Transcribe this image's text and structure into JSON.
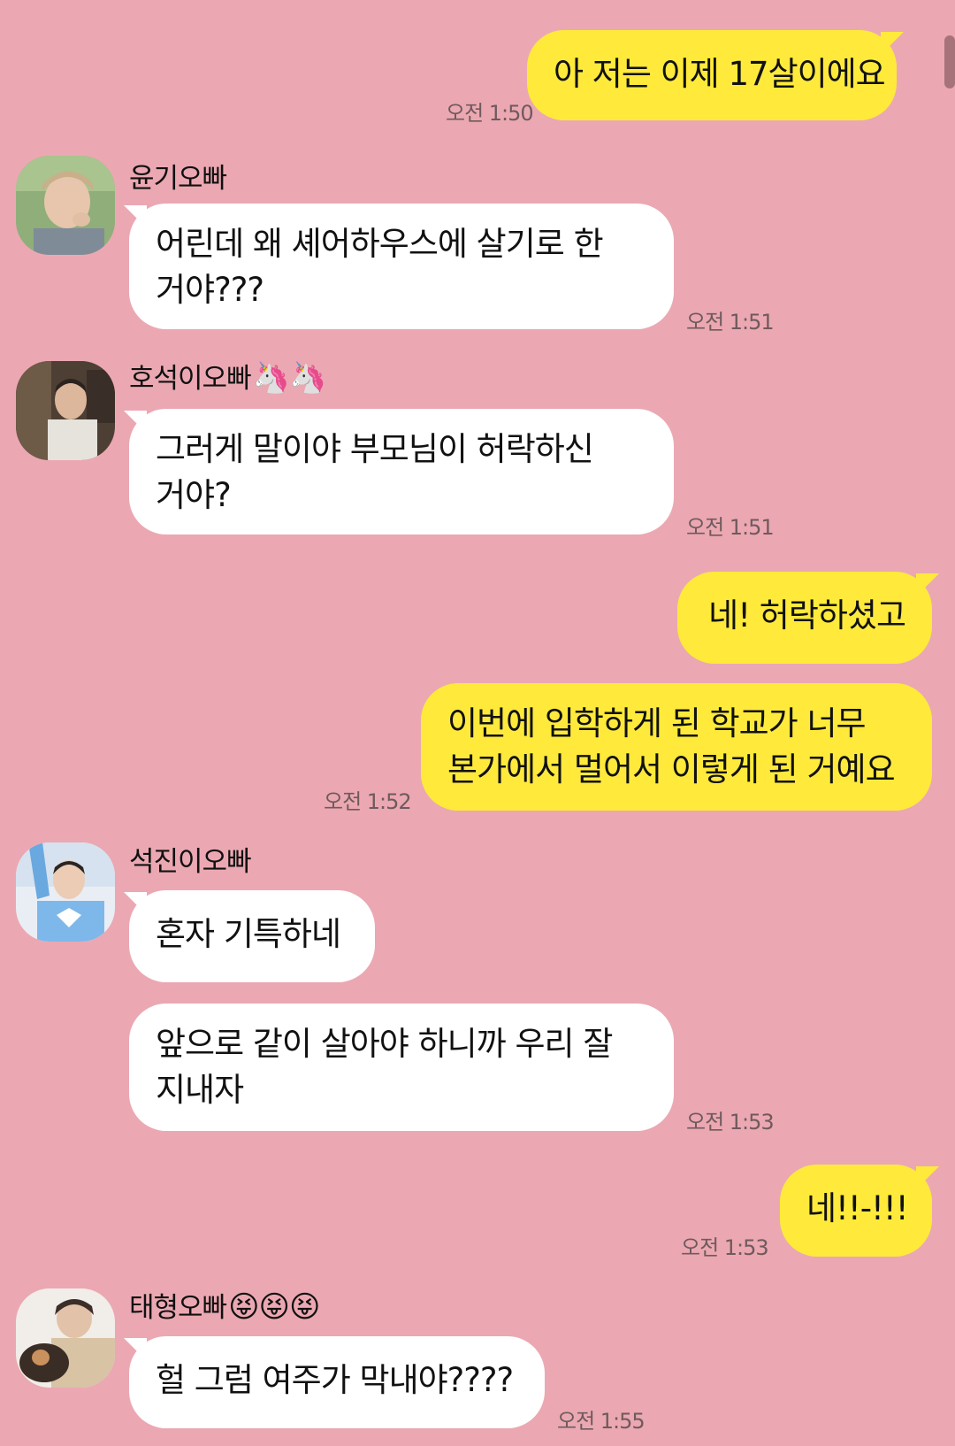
{
  "messages": [
    {
      "text_lines": [
        "아 저는 이제 17살이에요"
      ],
      "time": "오전 1:50"
    },
    {
      "sender": "윤기오빠",
      "text_lines": [
        "어린데 왜 셰어하우스에 살기로 한",
        "거야???"
      ],
      "time": "오전 1:51"
    },
    {
      "sender": "호석이오빠",
      "sender_emoji": "🦄🦄",
      "text_lines": [
        "그러게 말이야 부모님이 허락하신",
        "거야?"
      ],
      "time": "오전 1:51"
    },
    {
      "text_lines": [
        "네! 허락하셨고"
      ]
    },
    {
      "text_lines": [
        "이번에 입학하게 된 학교가 너무",
        "본가에서 멀어서 이렇게 된 거예요"
      ],
      "time": "오전 1:52"
    },
    {
      "sender": "석진이오빠",
      "text_lines": [
        "혼자 기특하네"
      ]
    },
    {
      "text_lines": [
        "앞으로 같이 살아야 하니까 우리 잘",
        "지내자"
      ],
      "time": "오전 1:53"
    },
    {
      "text_lines": [
        "네!!-!!!"
      ],
      "time": "오전 1:53"
    },
    {
      "sender": "태형오빠",
      "sender_emoji": "😝😝😝",
      "text_lines": [
        "헐 그럼 여주가 막내야????"
      ],
      "time": "오전 1:55"
    }
  ],
  "colors": {
    "background": "#eba8b2",
    "incoming_bubble": "#ffffff",
    "outgoing_bubble": "#ffea3b",
    "timestamp": "#6f5a5d"
  },
  "icons": {
    "avatar_1": "profile-photo-avatar",
    "avatar_2": "profile-photo-avatar",
    "avatar_3": "profile-photo-avatar",
    "avatar_4": "profile-photo-avatar"
  }
}
